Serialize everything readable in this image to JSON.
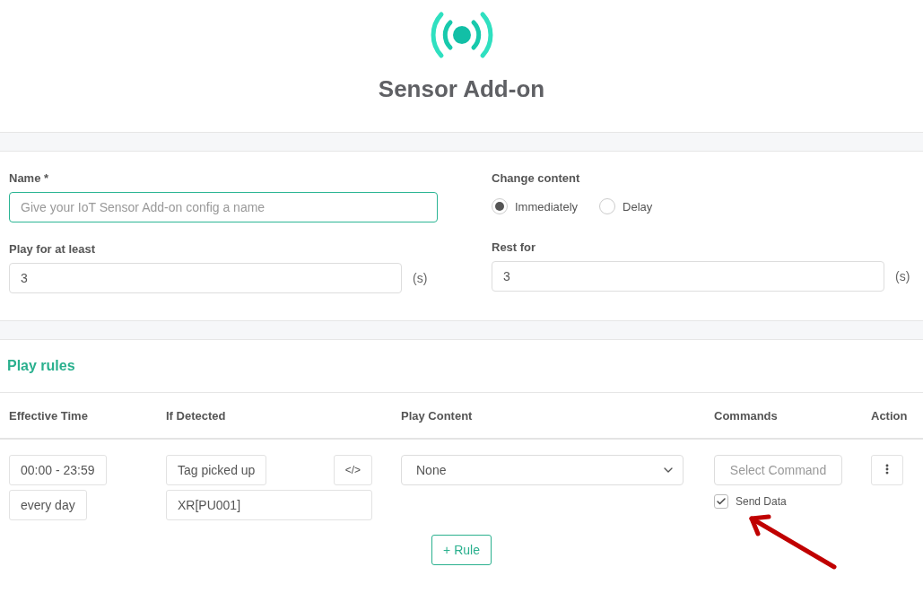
{
  "header": {
    "title": "Sensor Add-on"
  },
  "form": {
    "name": {
      "label": "Name *",
      "placeholder": "Give your IoT Sensor Add-on config a name"
    },
    "change_content": {
      "label": "Change content",
      "options": [
        {
          "label": "Immediately",
          "selected": true
        },
        {
          "label": "Delay",
          "selected": false
        }
      ]
    },
    "play_for": {
      "label": "Play for at least",
      "value": "3",
      "unit": "(s)"
    },
    "rest_for": {
      "label": "Rest for",
      "value": "3",
      "unit": "(s)"
    }
  },
  "play_rules": {
    "title": "Play rules",
    "columns": [
      "Effective Time",
      "If Detected",
      "Play Content",
      "Commands",
      "Action"
    ],
    "rows": [
      {
        "time": "00:00 - 23:59",
        "days": "every day",
        "event": "Tag picked up",
        "code_button": "</>",
        "tag": "XR[PU001]",
        "content": "None",
        "command_placeholder": "Select Command",
        "send_data": {
          "label": "Send Data",
          "checked": true
        }
      }
    ],
    "add_button": "+ Rule"
  }
}
